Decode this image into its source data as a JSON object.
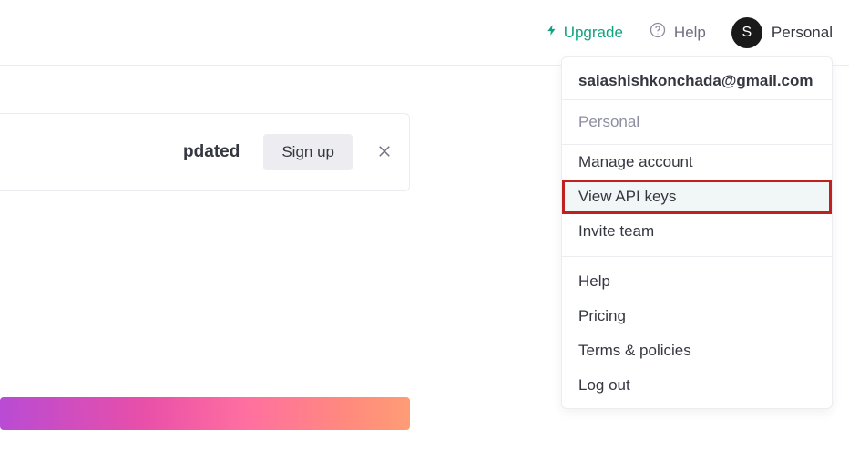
{
  "topbar": {
    "upgrade_label": "Upgrade",
    "help_label": "Help",
    "avatar_letter": "S",
    "account_label": "Personal"
  },
  "notice": {
    "text": "pdated",
    "signup_label": "Sign up"
  },
  "dropdown": {
    "email": "saiashishkonchada@gmail.com",
    "org": "Personal",
    "items_a": [
      "Manage account",
      "View API keys",
      "Invite team"
    ],
    "items_b": [
      "Help",
      "Pricing",
      "Terms & policies",
      "Log out"
    ],
    "highlighted_index": 1
  }
}
